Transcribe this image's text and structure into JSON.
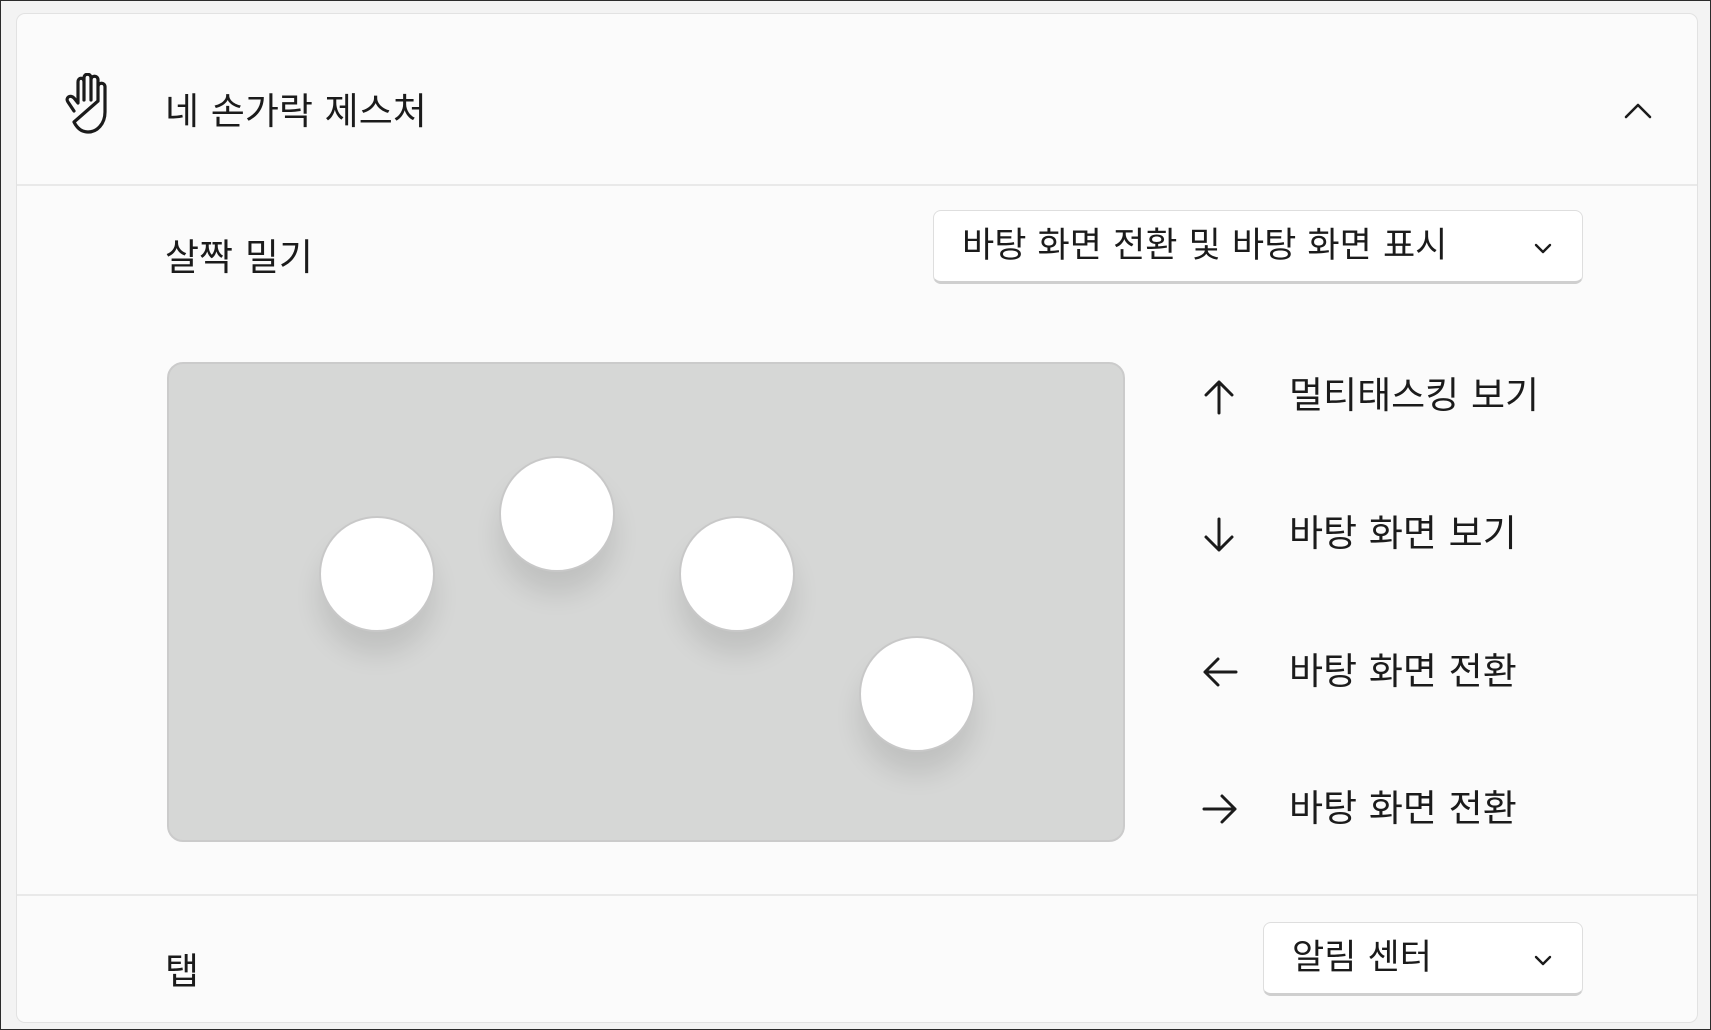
{
  "section": {
    "title": "네 손가락 제스처",
    "icon": "hand-icon",
    "toggle_icon": "chevron-up-icon"
  },
  "swipe": {
    "label": "살짝 밀기",
    "selected": "바탕 화면 전환 및 바탕 화면 표시",
    "directions": [
      {
        "icon": "arrow-up-icon",
        "label": "멀티태스킹 보기"
      },
      {
        "icon": "arrow-down-icon",
        "label": "바탕 화면 보기"
      },
      {
        "icon": "arrow-left-icon",
        "label": "바탕 화면 전환"
      },
      {
        "icon": "arrow-right-icon",
        "label": "바탕 화면 전환"
      }
    ]
  },
  "tap": {
    "label": "탭",
    "selected": "알림 센터"
  },
  "colors": {
    "card_bg": "#fbfbfb",
    "gesture_area": "#d6d7d6",
    "finger": "#ffffff"
  }
}
